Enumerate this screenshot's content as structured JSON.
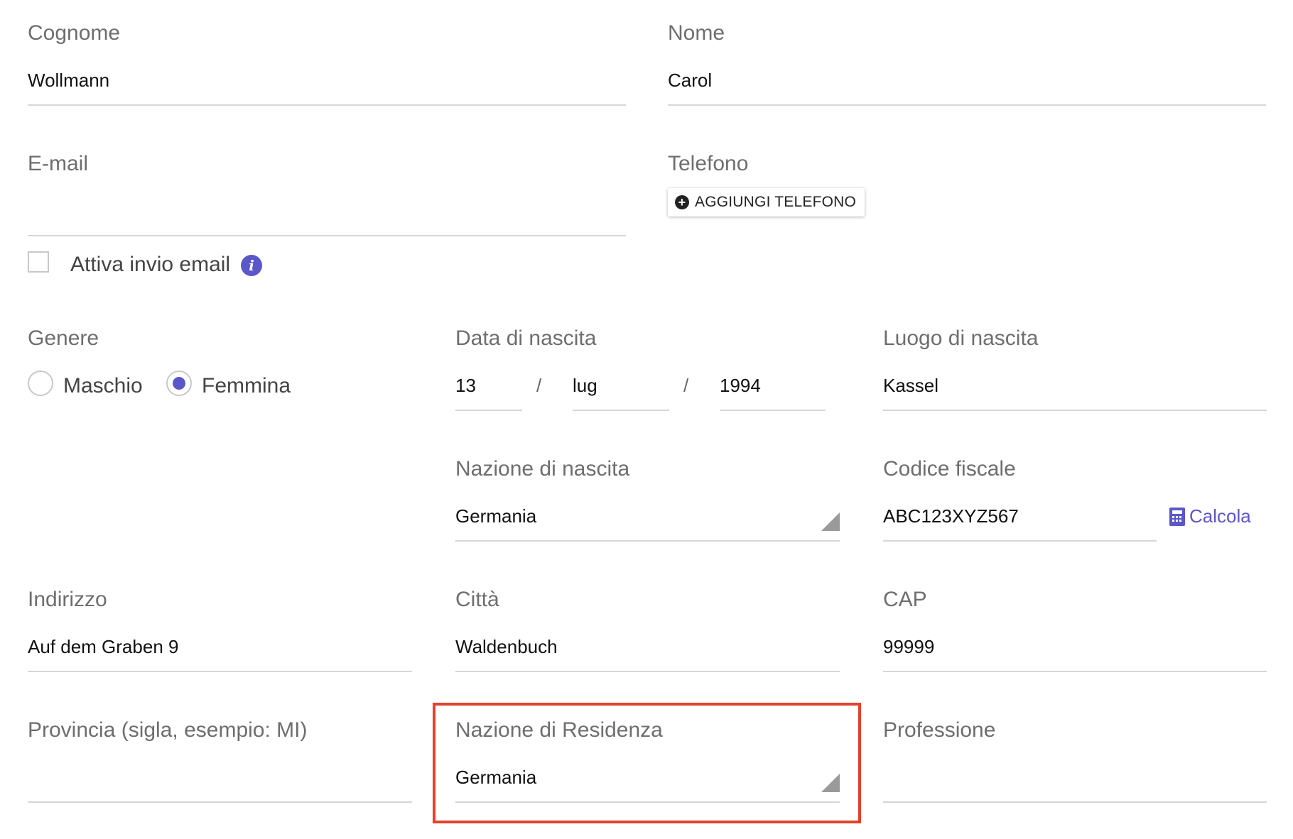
{
  "colors": {
    "accent": "#5b57c9",
    "highlight": "#e2422f",
    "label": "#6e6e6e",
    "underline": "#d6d6d6"
  },
  "fields": {
    "cognome": {
      "label": "Cognome",
      "value": "Wollmann"
    },
    "nome": {
      "label": "Nome",
      "value": "Carol"
    },
    "email": {
      "label": "E-mail",
      "value": ""
    },
    "telefono": {
      "label": "Telefono",
      "add_button": "AGGIUNGI TELEFONO"
    },
    "attiva_invio_email": {
      "label": "Attiva invio email",
      "checked": false,
      "icon": "info-icon"
    },
    "genere": {
      "label": "Genere",
      "options": [
        "Maschio",
        "Femmina"
      ],
      "selected": "Femmina"
    },
    "data_nascita": {
      "label": "Data di nascita",
      "day": "13",
      "month": "lug",
      "year": "1994",
      "separator": "/"
    },
    "luogo_nascita": {
      "label": "Luogo di nascita",
      "value": "Kassel"
    },
    "nazione_nascita": {
      "label": "Nazione di nascita",
      "value": "Germania"
    },
    "codice_fiscale": {
      "label": "Codice fiscale",
      "value": "ABC123XYZ567",
      "action": "Calcola",
      "action_icon": "calculator-icon"
    },
    "indirizzo": {
      "label": "Indirizzo",
      "value": "Auf dem Graben 9"
    },
    "citta": {
      "label": "Città",
      "value": "Waldenbuch"
    },
    "cap": {
      "label": "CAP",
      "value": "99999"
    },
    "provincia": {
      "label": "Provincia (sigla, esempio: MI)",
      "value": ""
    },
    "nazione_residenza": {
      "label": "Nazione di Residenza",
      "value": "Germania"
    },
    "professione": {
      "label": "Professione",
      "value": ""
    }
  }
}
